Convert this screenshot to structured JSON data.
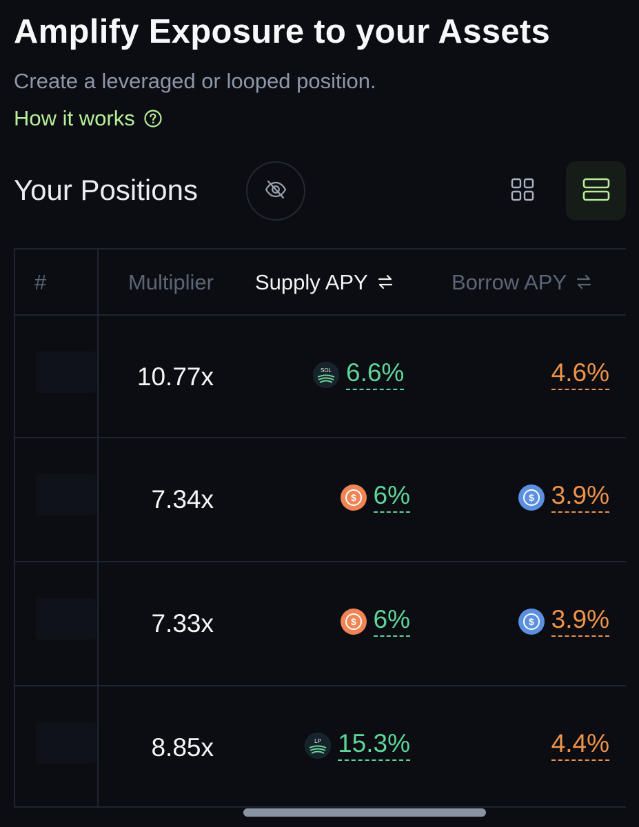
{
  "header": {
    "title": "Amplify Exposure to your Assets",
    "subtitle": "Create a leveraged or looped position.",
    "how_it_works": "How it works"
  },
  "positions": {
    "title": "Your Positions",
    "view_mode": "list"
  },
  "table": {
    "columns": {
      "number": "#",
      "multiplier": "Multiplier",
      "supply_apy": "Supply APY",
      "borrow_apy": "Borrow APY"
    },
    "rows": [
      {
        "multiplier": "10.77x",
        "supply_apy": "6.6%",
        "supply_token_icon": "sol-token-icon",
        "supply_token_label": "SOL",
        "borrow_apy": "4.6%",
        "borrow_token_icon": ""
      },
      {
        "multiplier": "7.34x",
        "supply_apy": "6%",
        "supply_token_icon": "usdc-orange-token-icon",
        "supply_token_label": "",
        "borrow_apy": "3.9%",
        "borrow_token_icon": "usdc-blue-token-icon"
      },
      {
        "multiplier": "7.33x",
        "supply_apy": "6%",
        "supply_token_icon": "usdc-orange-token-icon",
        "supply_token_label": "",
        "borrow_apy": "3.9%",
        "borrow_token_icon": "usdc-blue-token-icon"
      },
      {
        "multiplier": "8.85x",
        "supply_apy": "15.3%",
        "supply_token_icon": "lp-token-icon",
        "supply_token_label": "LP",
        "borrow_apy": "4.4%",
        "borrow_token_icon": ""
      }
    ]
  },
  "colors": {
    "background": "#0b0d12",
    "accent_green": "#b8ef9a",
    "apy_green": "#5ed59a",
    "apy_orange": "#f0934a",
    "usdc_orange": "#f08454",
    "usdc_blue": "#5b8fe0"
  }
}
